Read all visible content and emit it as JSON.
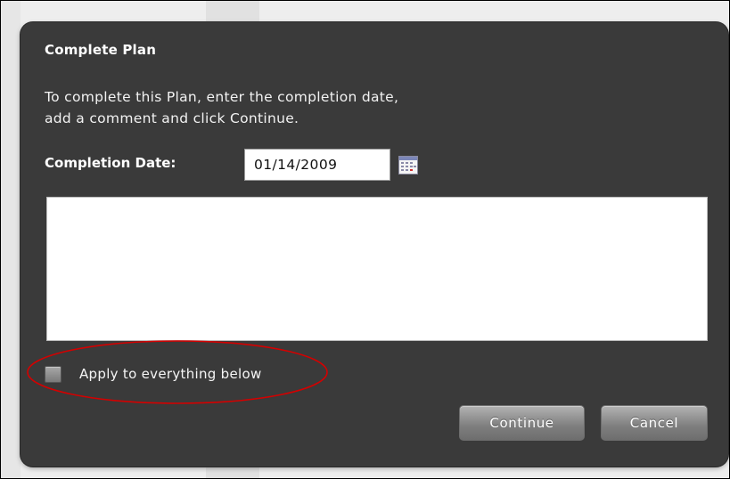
{
  "dialog": {
    "title": "Complete Plan",
    "instructions_line1": "To complete this Plan, enter the completion date,",
    "instructions_line2": "add a comment and click Continue.",
    "date_label": "Completion Date:",
    "date_value": "01/14/2009",
    "calendar_icon": "calendar-icon",
    "comment_value": "",
    "apply_checked": false,
    "apply_label": "Apply to everything below",
    "continue_label": "Continue",
    "cancel_label": "Cancel"
  },
  "colors": {
    "dialog_bg": "#3a3a3a",
    "button_gray": "#8a8a8a",
    "annotation_red": "#d40000"
  }
}
